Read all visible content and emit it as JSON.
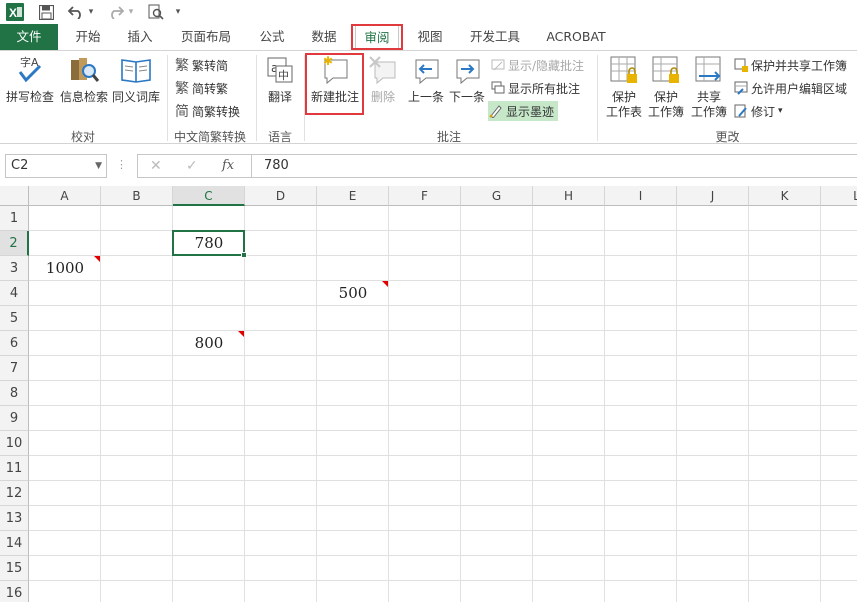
{
  "qat": {
    "excel_icon": "excel-logo-icon",
    "save_icon": "save-icon",
    "undo_icon": "undo-icon",
    "redo_icon": "redo-icon",
    "preview_icon": "print-preview-icon",
    "customize_icon": "customize-qat-icon"
  },
  "tabs": [
    "文件",
    "开始",
    "插入",
    "页面布局",
    "公式",
    "数据",
    "审阅",
    "视图",
    "开发工具",
    "ACROBAT"
  ],
  "active_tab": "审阅",
  "ribbon": {
    "proofing": {
      "spell_check": "拼写检查",
      "research": "信息检索",
      "thesaurus": "同义词库",
      "group_label": "校对"
    },
    "chinese_conversion": {
      "to_traditional": "繁转简",
      "to_simplified": "简转繁",
      "convert": "简繁转换",
      "group_label": "中文简繁转换"
    },
    "language": {
      "translate": "翻译",
      "group_label": "语言"
    },
    "comments": {
      "new_comment": "新建批注",
      "delete": "删除",
      "previous": "上一条",
      "next": "下一条",
      "show_hide": "显示/隐藏批注",
      "show_all": "显示所有批注",
      "show_ink": "显示墨迹",
      "group_label": "批注"
    },
    "changes": {
      "protect_sheet_1": "保护",
      "protect_sheet_2": "工作表",
      "protect_workbook_1": "保护",
      "protect_workbook_2": "工作簿",
      "share_workbook_1": "共享",
      "share_workbook_2": "工作簿",
      "protect_and_share": "保护并共享工作簿",
      "allow_edit_ranges": "允许用户编辑区域",
      "track_changes": "修订",
      "group_label": "更改"
    }
  },
  "formula_bar": {
    "name_box": "C2",
    "value": "780",
    "fx_label": "fx"
  },
  "sheet": {
    "columns": [
      "A",
      "B",
      "C",
      "D",
      "E",
      "F",
      "G",
      "H",
      "I",
      "J",
      "K",
      "L"
    ],
    "rows": [
      "1",
      "2",
      "3",
      "4",
      "5",
      "6",
      "7",
      "8",
      "9",
      "10",
      "11",
      "12",
      "13",
      "14",
      "15",
      "16"
    ],
    "selected_column": "C",
    "selected_row": "2",
    "cells": {
      "C2": "780",
      "A3": "1000",
      "E4": "500",
      "C6": "800"
    }
  },
  "colors": {
    "accent": "#217346",
    "highlight": "#e0393e",
    "comment_marker": "#e00000"
  }
}
